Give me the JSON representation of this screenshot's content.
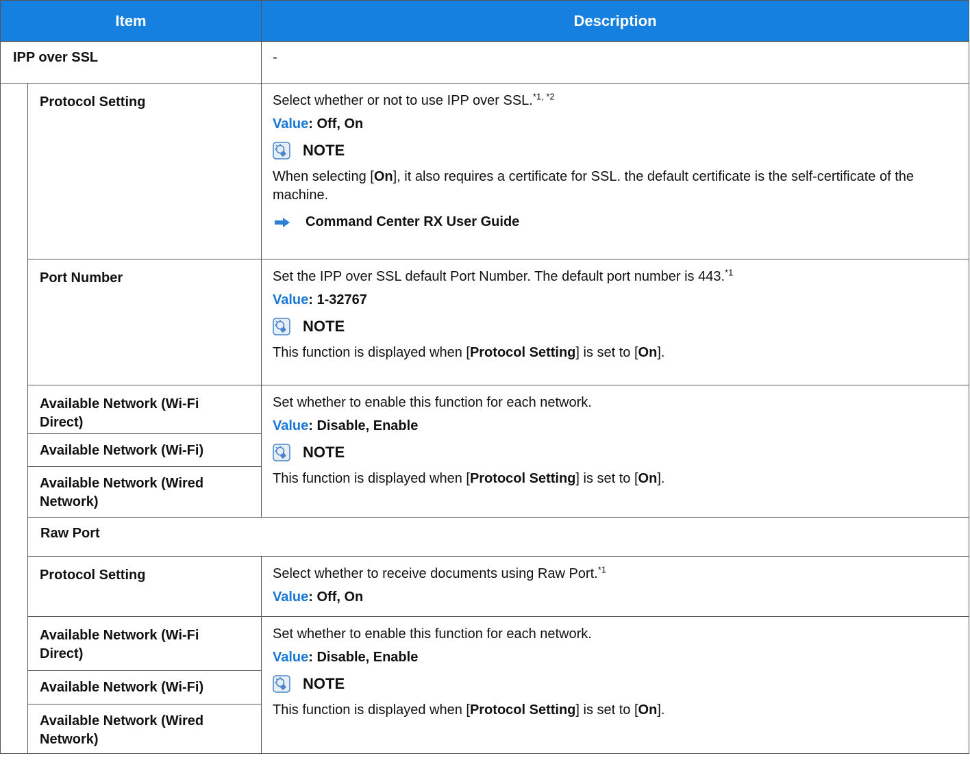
{
  "header": {
    "col_item": "Item",
    "col_description": "Description"
  },
  "ipp_over_ssl": {
    "title": "IPP over SSL",
    "desc": "-",
    "protocol_setting": {
      "label": "Protocol Setting",
      "text": "Select whether or not to use IPP over SSL.",
      "sup": "*1, *2",
      "value_label": "Value",
      "value": ": Off, On",
      "note_title": "NOTE",
      "note_text_1": "When selecting [",
      "note_text_bold": "On",
      "note_text_2": "], it also requires a certificate for SSL. the default certificate is the self-certificate of the machine.",
      "ref": "Command Center RX User Guide"
    },
    "port_number": {
      "label": "Port Number",
      "text": "Set the IPP over SSL default Port Number. The default port number is 443.",
      "sup": "*1",
      "value_label": "Value",
      "value": ": 1-32767",
      "note_title": "NOTE",
      "note_pre": "This function is displayed when [",
      "note_bold1": "Protocol Setting",
      "note_mid": "] is set to [",
      "note_bold2": "On",
      "note_post": "]."
    },
    "available_network": {
      "label_wifi_direct": "Available Network (Wi-Fi Direct)",
      "label_wifi": "Available Network (Wi-Fi)",
      "label_wired": "Available Network (Wired Network)",
      "text": "Set whether to enable this function for each network.",
      "value_label": "Value",
      "value": ": Disable, Enable",
      "note_title": "NOTE",
      "note_pre": "This function is displayed when [",
      "note_bold1": "Protocol Setting",
      "note_mid": "] is set to [",
      "note_bold2": "On",
      "note_post": "]."
    }
  },
  "raw_port": {
    "title": "Raw Port",
    "desc": "-",
    "protocol_setting": {
      "label": "Protocol Setting",
      "text": "Select whether to receive documents using Raw Port.",
      "sup": "*1",
      "value_label": "Value",
      "value": ": Off, On"
    },
    "available_network": {
      "label_wifi_direct": "Available Network (Wi-Fi Direct)",
      "label_wifi": "Available Network (Wi-Fi)",
      "label_wired": "Available Network (Wired Network)",
      "text": "Set whether to enable this function for each network.",
      "value_label": "Value",
      "value": ": Disable, Enable",
      "note_title": "NOTE",
      "note_pre": "This function is displayed when [",
      "note_bold1": "Protocol Setting",
      "note_mid": "] is set to [",
      "note_bold2": "On",
      "note_post": "]."
    }
  },
  "icons": {
    "note": "note-lightbulb-icon",
    "ref": "arrow-right-icon"
  },
  "colors": {
    "header_bg": "#1680e0",
    "value_label": "#1677d6",
    "icon": "#4a86c8"
  }
}
